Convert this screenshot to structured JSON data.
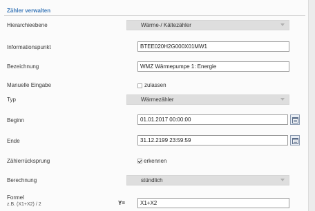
{
  "section_title": "Zähler verwalten",
  "fields": {
    "hierarchy": {
      "label": "Hierarchieebene",
      "value": "Wärme-/ Kältezähler"
    },
    "info_point": {
      "label": "Informationspunkt",
      "value": "BTEE020H2G000X01MW1"
    },
    "designation": {
      "label": "Bezeichnung",
      "value": "WMZ Wärmepumpe 1: Energie"
    },
    "manual_entry": {
      "label": "Manuelle Eingabe",
      "option": "zulassen",
      "checked": false
    },
    "type": {
      "label": "Typ",
      "value": "Wärmezähler"
    },
    "start": {
      "label": "Beginn",
      "value": "01.01.2017 00:00:00"
    },
    "end": {
      "label": "Ende",
      "value": "31.12.2199 23:59:59"
    },
    "counter_reset": {
      "label": "Zählerrücksprung",
      "option": "erkennen",
      "checked": true
    },
    "calculation": {
      "label": "Berechnung",
      "value": "stündlich"
    },
    "formula": {
      "label": "Formel",
      "hint": "z.B. (X1+X2) / 2",
      "prefix": "Y=",
      "value": "X1+X2"
    }
  },
  "icons": {
    "calendar": "calendar-icon",
    "dropdown": "chevron-down-icon"
  }
}
